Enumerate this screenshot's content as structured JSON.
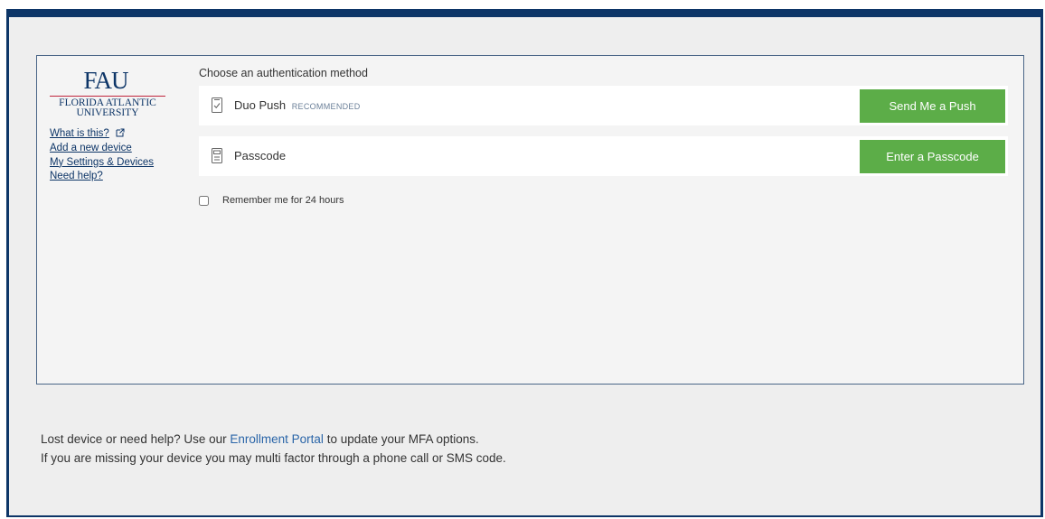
{
  "sidebar": {
    "logo": {
      "mark": "FAU",
      "line1": "FLORIDA ATLANTIC",
      "line2": "UNIVERSITY"
    },
    "links": [
      {
        "label": "What is this?"
      },
      {
        "label": "Add a new device"
      },
      {
        "label": "My Settings & Devices"
      },
      {
        "label": "Need help?"
      }
    ]
  },
  "prompt": {
    "title": "Choose an authentication method",
    "methods": [
      {
        "label": "Duo Push",
        "badge": "RECOMMENDED",
        "button": "Send Me a Push",
        "icon": "phone-check-icon"
      },
      {
        "label": "Passcode",
        "badge": "",
        "button": "Enter a Passcode",
        "icon": "passcode-fob-icon"
      }
    ],
    "remember_label": "Remember me for 24 hours",
    "remember_checked": false
  },
  "help": {
    "line1_prefix": "Lost device or need help? Use our ",
    "line1_link": "Enrollment Portal",
    "line1_suffix": " to update your MFA options.",
    "line2": "If you are missing your device you may multi factor through a phone call or SMS code."
  },
  "colors": {
    "navy": "#0d3567",
    "button_green": "#5cad48",
    "link_blue": "#2a65a8",
    "logo_red": "#c0243c"
  }
}
